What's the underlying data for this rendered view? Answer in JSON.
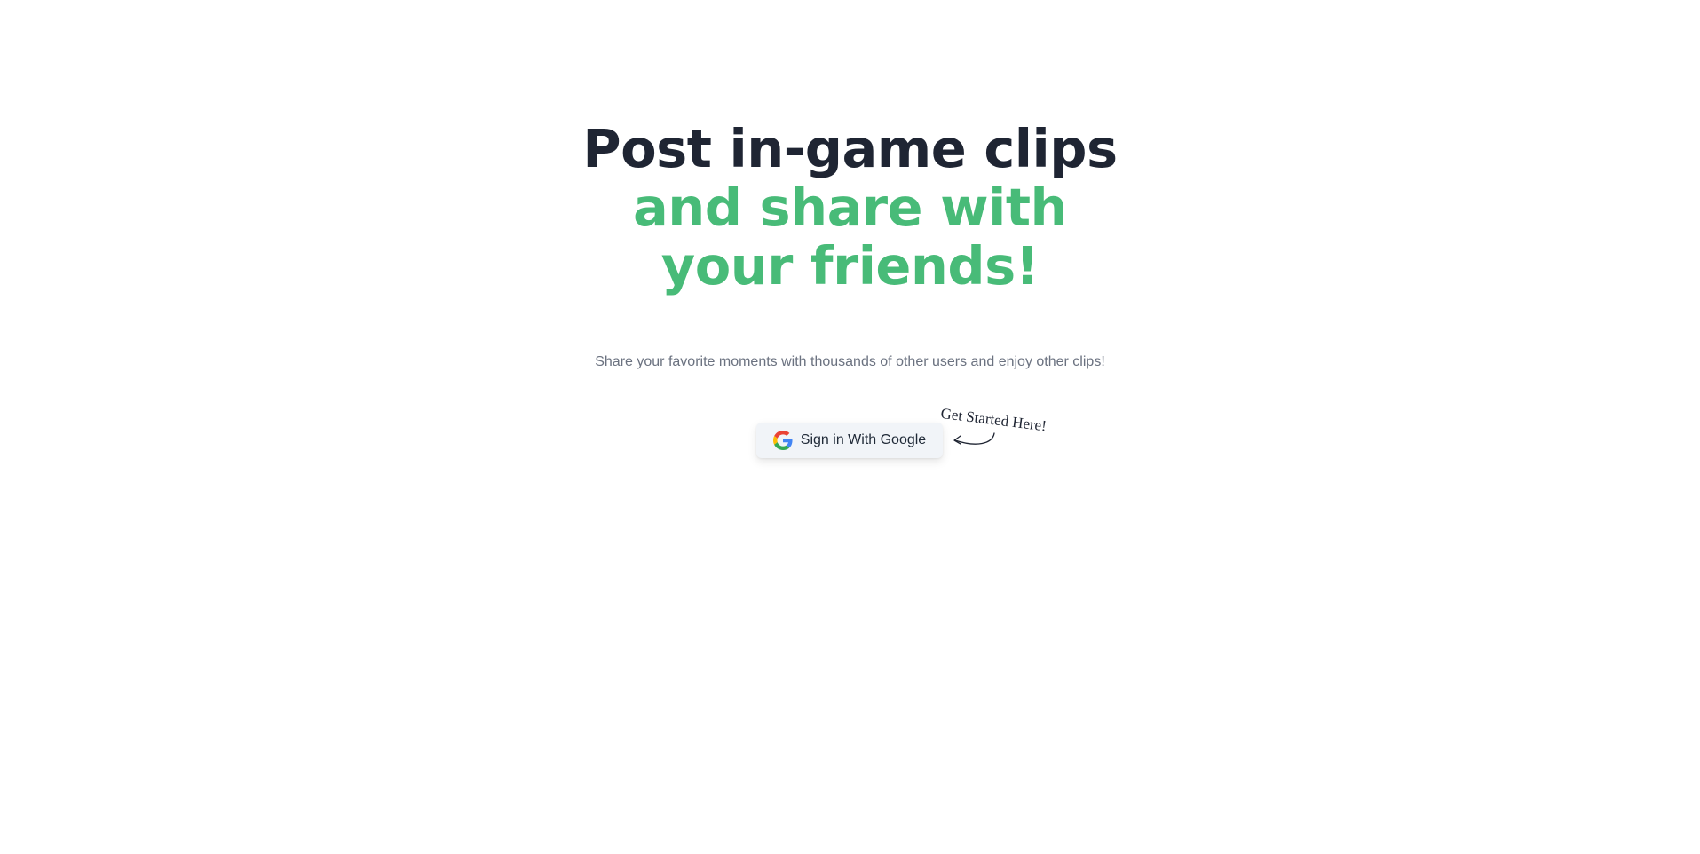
{
  "hero": {
    "headline_line1": "Post in-game clips",
    "headline_line2": "and share with your friends!",
    "subtitle": "Share your favorite moments with thousands of other users and enjoy other clips!"
  },
  "signin": {
    "label": "Sign in With Google",
    "icon": "google-icon"
  },
  "annotation": {
    "text": "Get Started Here!",
    "icon": "curved-arrow-icon"
  },
  "colors": {
    "accent": "#48bb78",
    "heading": "#1f2533",
    "muted": "#6b7280",
    "button_bg": "#f1f4f8"
  }
}
